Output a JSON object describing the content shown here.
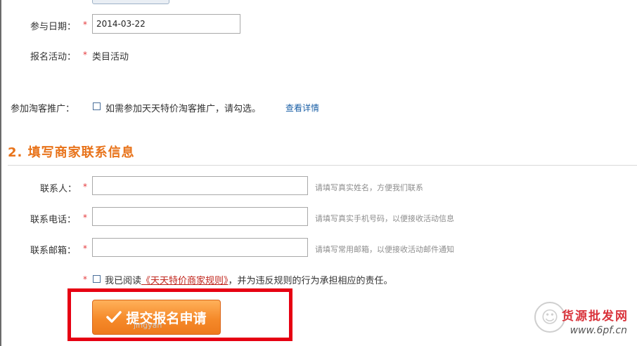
{
  "form": {
    "date": {
      "label": "参与日期：",
      "required_mark": "*",
      "value": "2014-03-22"
    },
    "activity": {
      "label": "报名活动：",
      "required_mark": "*",
      "value": "类目活动"
    },
    "taoke": {
      "label": "参加淘客推广：",
      "checkbox_label": "如需参加天天特价淘客推广，请勾选。",
      "details_link": "查看详情"
    }
  },
  "section2": {
    "title": "2. 填写商家联系信息",
    "contact": {
      "label": "联系人：",
      "required_mark": "*",
      "value": "",
      "hint": "请填写真实姓名，方便我们联系"
    },
    "phone": {
      "label": "联系电话：",
      "required_mark": "*",
      "value": "",
      "hint": "请填写真实手机号码，以便接收活动信息"
    },
    "email": {
      "label": "联系邮箱：",
      "required_mark": "*",
      "value": "",
      "hint": "请填写常用邮箱，以便接收活动邮件通知"
    },
    "agreement": {
      "required_mark": "*",
      "prefix": "我已阅读",
      "rules_link": "《天天特价商家规则》",
      "suffix": "，并为违反规则的行为承担相应的责任。"
    },
    "submit_label": "提交报名申请",
    "submit_icon": "check-icon"
  },
  "watermark": {
    "site_name": "货源批发网",
    "url": "www.6pf.cn",
    "faint_text": "jingyan"
  },
  "colors": {
    "section_title": "#e8731a",
    "required": "#e4393c",
    "button": "#f58a2a",
    "highlight_box": "#e60012",
    "link": "#1a5fa6"
  }
}
